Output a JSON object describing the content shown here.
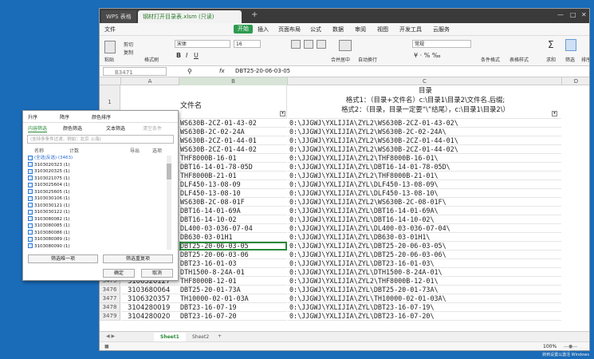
{
  "app": {
    "tab_wps": "WPS 表格",
    "tab_file": "钢材打开目录表.xlsm (只读)",
    "tab_add": "+"
  },
  "menu": [
    "文件",
    "开始",
    "插入",
    "页面布局",
    "公式",
    "数据",
    "审阅",
    "视图",
    "开发工具",
    "云服务"
  ],
  "ribbon": {
    "cut": "剪切",
    "paste": "粘贴",
    "copy": "复制",
    "format_painter": "格式刷",
    "font": "宋体",
    "font_size": "16",
    "merge": "合并居中",
    "wrap": "自动换行",
    "number_format": "常规",
    "cond_format": "条件格式",
    "table_style": "表格样式",
    "sum": "求和",
    "filter": "筛选",
    "sort": "排序"
  },
  "formula": {
    "namebox": "B3471",
    "fx": "fx",
    "value": "DBT25-20-06-03-05"
  },
  "columns": [
    "A",
    "B",
    "C",
    "D"
  ],
  "header_row": {
    "row": "1",
    "b": "文件名",
    "c_title": "目录",
    "c_line1": "格式1：（目录+文件名）c:\\目录1\\目录2\\文件名.后缀;",
    "c_line2": "格式2：（目录，目录一定要“\\”结尾），c:\\目录1\\目录2\\）"
  },
  "rows": [
    {
      "n": "",
      "a": "",
      "b": "WS630B-2CZ-01-43-02",
      "c": "0:\\JJGWJ\\YXLIJIA\\ZYL2\\WS630B-2CZ-01-43-02\\"
    },
    {
      "n": "",
      "a": "",
      "b": "WS630B-2C-02-24A",
      "c": "0:\\JJGWJ\\YXLIJIA\\ZYL2\\WS630B-2C-02-24A\\"
    },
    {
      "n": "",
      "a": "",
      "b": "WS630B-2CZ-01-44-01",
      "c": "0:\\JJGWJ\\YXLIJIA\\ZYL2\\WS630B-2CZ-01-44-01\\"
    },
    {
      "n": "",
      "a": "",
      "b": "WS630B-2CZ-01-44-02",
      "c": "0:\\JJGWJ\\YXLIJIA\\ZYL2\\WS630B-2CZ-01-44-02\\"
    },
    {
      "n": "",
      "a": "",
      "b": "THF8000B-16-01",
      "c": "0:\\JJGWJ\\YXLIJIA\\ZYL2\\THF8000B-16-01\\"
    },
    {
      "n": "",
      "a": "",
      "b": "DBT16-14-01-78-05D",
      "c": "0:\\JJGWJ\\YXLIJIA\\ZYL\\DBT16-14-01-78-05D\\"
    },
    {
      "n": "",
      "a": "",
      "b": "THF8000B-21-01",
      "c": "0:\\JJGWJ\\YXLIJIA\\ZYL2\\THF8000B-21-01\\"
    },
    {
      "n": "",
      "a": "",
      "b": "DLF450-13-08-09",
      "c": "0:\\JJGWJ\\YXLIJIA\\ZYL\\DLF450-13-08-09\\"
    },
    {
      "n": "",
      "a": "",
      "b": "DLF450-13-08-10",
      "c": "0:\\JJGWJ\\YXLIJIA\\ZYL\\DLF450-13-08-10\\"
    },
    {
      "n": "",
      "a": "",
      "b": "WS630B-2C-08-01F",
      "c": "0:\\JJGWJ\\YXLIJIA\\ZYL2\\WS630B-2C-08-01F\\"
    },
    {
      "n": "",
      "a": "",
      "b": "DBT16-14-01-69A",
      "c": "0:\\JJGWJ\\YXLIJIA\\ZYL\\DBT16-14-01-69A\\"
    },
    {
      "n": "",
      "a": "",
      "b": "DBT16-14-10-02",
      "c": "0:\\JJGWJ\\YXLIJIA\\ZYL\\DBT16-14-10-02\\"
    },
    {
      "n": "",
      "a": "",
      "b": "DL400-03-036-07-04",
      "c": "0:\\JJGWJ\\YXLIJIA\\ZYL\\DL400-03-036-07-04\\"
    },
    {
      "n": "",
      "a": "",
      "b": "DB630-03-01H1",
      "c": "0:\\JJGWJ\\YXLIJIA\\ZYL\\DB630-03-01H1\\"
    },
    {
      "n": "",
      "a": "",
      "b": "DBT25-20-06-03-05",
      "c": "0:\\JJGWJ\\YXLIJIA\\ZYL\\DBT25-20-06-03-05\\"
    },
    {
      "n": "",
      "a": "",
      "b": "DBT25-20-06-03-06",
      "c": "0:\\JJGWJ\\YXLIJIA\\ZYL\\DBT25-20-06-03-06\\"
    },
    {
      "n": "",
      "a": "",
      "b": "DBT23-16-01-03",
      "c": "0:\\JJGWJ\\YXLIJIA\\ZYL\\DBT23-16-01-03\\"
    },
    {
      "n": "",
      "a": "",
      "b": "DTH1500-8-24A-01",
      "c": "0:\\JJGWJ\\YXLIJIA\\ZYL\\DTH1500-8-24A-01\\"
    },
    {
      "n": "3475",
      "a": "3106520127",
      "b": "THF8000B-12-01",
      "c": "0:\\JJGWJ\\YXLIJIA\\ZYL2\\THF8000B-12-01\\"
    },
    {
      "n": "3476",
      "a": "3103680064",
      "b": "DBT25-20-01-73A",
      "c": "0:\\JJGWJ\\YXLIJIA\\ZYL\\DBT25-20-01-73A\\"
    },
    {
      "n": "3477",
      "a": "3106320357",
      "b": "TH10000-02-01-03A",
      "c": "0:\\JJGWJ\\YXLIJIA\\ZYL\\TH10000-02-01-03A\\"
    },
    {
      "n": "3478",
      "a": "3104280019",
      "b": "DBT23-16-07-19",
      "c": "0:\\JJGWJ\\YXLIJIA\\ZYL\\DBT23-16-07-19\\"
    },
    {
      "n": "3479",
      "a": "3104280020",
      "b": "DBT23-16-07-20",
      "c": "0:\\JJGWJ\\YXLIJIA\\ZYL\\DBT23-16-07-20\\"
    }
  ],
  "filter_panel": {
    "sort_asc": "升序",
    "sort_desc": "降序",
    "sort_color": "颜色排序",
    "tab_content": "内容筛选",
    "tab_color": "颜色筛选",
    "tab_text": "文本筛选",
    "tab_clear": "清空条件",
    "search_placeholder": "(支持多条件过滤，例如：北京 上海)",
    "col_name": "名称",
    "col_count": "计数",
    "export": "导出",
    "options": "选项",
    "items": [
      "(全选|反选) (3463)",
      "3103020323 (1)",
      "3103020325 (1)",
      "3103021075 (1)",
      "3103025604 (1)",
      "3103025605 (1)",
      "3103030106 (1)",
      "3103030121 (1)",
      "3103030122 (1)",
      "3103080082 (1)",
      "3103080085 (1)",
      "3103080086 (1)",
      "3103080089 (1)",
      "3103080090 (1)"
    ],
    "filter_unique": "筛选唯一项",
    "filter_dup": "筛选重复项",
    "ok": "确定",
    "cancel": "取消"
  },
  "sheets": [
    "Sheet1",
    "Sheet2"
  ],
  "status": {
    "zoom": "100%"
  },
  "taskbar": {
    "line1": "激活 Windows",
    "line2": "转到设置以激活 Windows"
  }
}
